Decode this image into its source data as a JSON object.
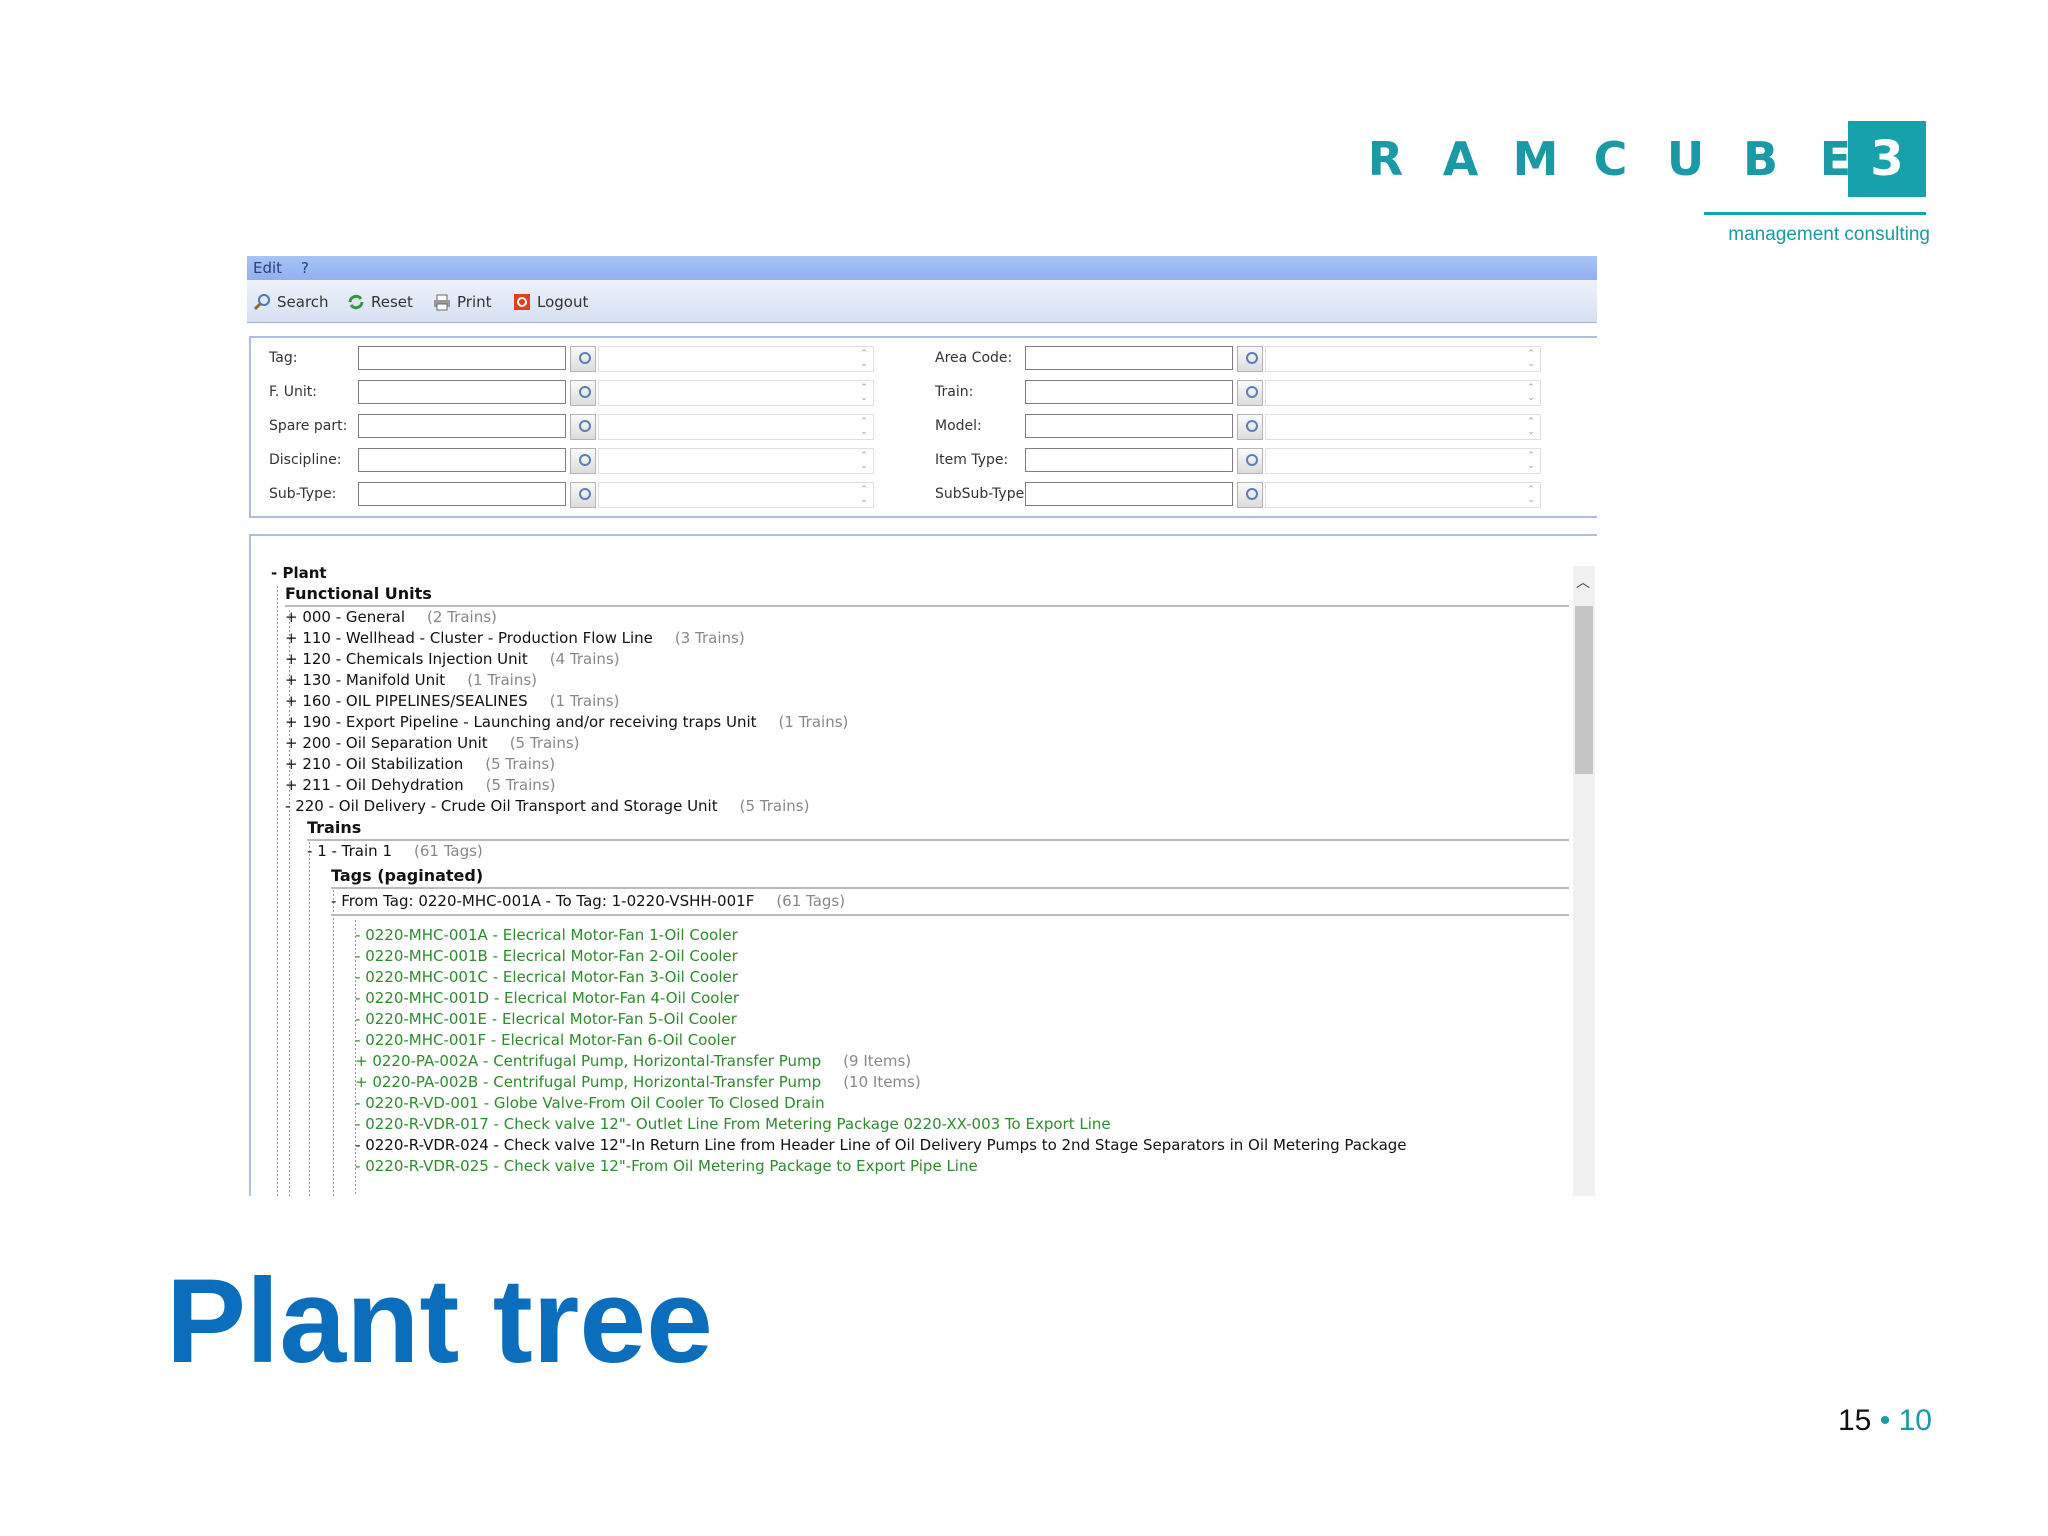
{
  "logo": {
    "letters": [
      "R",
      "A",
      "M",
      "C",
      "U",
      "B",
      "E"
    ],
    "box": "3",
    "tagline": "management consulting"
  },
  "menu": {
    "edit": "Edit",
    "help": "?"
  },
  "toolbar": {
    "search": "Search",
    "reset": "Reset",
    "print": "Print",
    "logout": "Logout"
  },
  "form": {
    "left": [
      "Tag:",
      "F. Unit:",
      "Spare part:",
      "Discipline:",
      "Sub-Type:"
    ],
    "right": [
      "Area Code:",
      "Train:",
      "Model:",
      "Item Type:",
      "SubSub-Type:"
    ]
  },
  "tree": {
    "plant": "Plant",
    "functional_units": "Functional Units",
    "units": [
      {
        "label": "000 - General",
        "count": "(2 Trains)"
      },
      {
        "label": "110 - Wellhead - Cluster - Production Flow Line",
        "count": "(3 Trains)"
      },
      {
        "label": "120 - Chemicals Injection Unit",
        "count": "(4 Trains)"
      },
      {
        "label": "130 - Manifold Unit",
        "count": "(1 Trains)"
      },
      {
        "label": "160 - OIL PIPELINES/SEALINES",
        "count": "(1 Trains)"
      },
      {
        "label": "190 - Export Pipeline - Launching and/or receiving traps Unit",
        "count": "(1 Trains)"
      },
      {
        "label": "200 - Oil Separation Unit",
        "count": "(5 Trains)"
      },
      {
        "label": "210 - Oil Stabilization",
        "count": "(5 Trains)"
      },
      {
        "label": "211 - Oil Dehydration",
        "count": "(5 Trains)"
      },
      {
        "label": "220 - Oil Delivery - Crude Oil Transport and Storage Unit",
        "count": "(5 Trains)"
      }
    ],
    "trains": "Trains",
    "train1": {
      "label": "1 - Train 1",
      "count": "(61 Tags)"
    },
    "tags_paginated": "Tags (paginated)",
    "range": {
      "label": "From Tag: 0220-MHC-001A - To Tag: 1-0220-VSHH-001F",
      "count": "(61 Tags)"
    },
    "tags": [
      {
        "sign": "-",
        "label": "0220-MHC-001A - Elecrical Motor-Fan 1-Oil Cooler",
        "count": "",
        "green": true
      },
      {
        "sign": "-",
        "label": "0220-MHC-001B - Elecrical Motor-Fan 2-Oil Cooler",
        "count": "",
        "green": true
      },
      {
        "sign": "-",
        "label": "0220-MHC-001C - Elecrical Motor-Fan 3-Oil Cooler",
        "count": "",
        "green": true
      },
      {
        "sign": "-",
        "label": "0220-MHC-001D - Elecrical Motor-Fan 4-Oil Cooler",
        "count": "",
        "green": true
      },
      {
        "sign": "-",
        "label": "0220-MHC-001E - Elecrical Motor-Fan 5-Oil Cooler",
        "count": "",
        "green": true
      },
      {
        "sign": "-",
        "label": "0220-MHC-001F - Elecrical Motor-Fan 6-Oil Cooler",
        "count": "",
        "green": true
      },
      {
        "sign": "+",
        "label": "0220-PA-002A - Centrifugal Pump, Horizontal-Transfer Pump",
        "count": "(9 Items)",
        "green": true
      },
      {
        "sign": "+",
        "label": "0220-PA-002B - Centrifugal Pump, Horizontal-Transfer Pump",
        "count": "(10 Items)",
        "green": true
      },
      {
        "sign": "-",
        "label": "0220-R-VD-001 - Globe Valve-From Oil Cooler To Closed Drain",
        "count": "",
        "green": true
      },
      {
        "sign": "-",
        "label": "0220-R-VDR-017 - Check valve 12\"- Outlet Line From Metering Package 0220-XX-003 To Export Line",
        "count": "",
        "green": true
      },
      {
        "sign": "-",
        "label": "0220-R-VDR-024 - Check valve 12\"-In Return Line from Header Line of Oil Delivery Pumps to 2nd Stage Separators in Oil Metering Package",
        "count": "",
        "green": false
      },
      {
        "sign": "-",
        "label": "0220-R-VDR-025 - Check valve 12\"-From Oil Metering Package to Export Pipe Line",
        "count": "",
        "green": true
      }
    ]
  },
  "slide": {
    "title": "Plant tree",
    "page": "15",
    "sep": "•",
    "total": "10"
  }
}
